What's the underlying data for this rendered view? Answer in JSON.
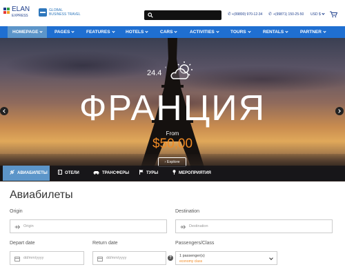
{
  "header": {
    "logo": {
      "name": "ELAN",
      "sub": "EXPRESS"
    },
    "partner": {
      "line1": "GLOBAL",
      "line2": "BUSINESS TRAVEL"
    },
    "phones": [
      "+(99890) 970-12-34",
      "+(99871) 150-25-50"
    ],
    "currency": "USD $"
  },
  "nav": {
    "items": [
      {
        "label": "Homepage"
      },
      {
        "label": "Pages"
      },
      {
        "label": "Features"
      },
      {
        "label": "Hotels"
      },
      {
        "label": "Cars"
      },
      {
        "label": "Activities"
      },
      {
        "label": "Tours"
      },
      {
        "label": "Rentals"
      },
      {
        "label": "Partner"
      }
    ]
  },
  "hero": {
    "temperature": "24.4",
    "degree": "°",
    "title": "ФРАНЦИЯ",
    "from_label": "From",
    "price": "$50,00",
    "cta": "Explore"
  },
  "tabs": [
    {
      "label": "АВИАБИЛЕТЫ",
      "icon": "plane-icon",
      "active": true
    },
    {
      "label": "ОТЕЛИ",
      "icon": "building-icon"
    },
    {
      "label": "ТРАНСФЕРЫ",
      "icon": "car-icon"
    },
    {
      "label": "ТУРЫ",
      "icon": "flag-icon"
    },
    {
      "label": "МЕРОПРИЯТИЯ",
      "icon": "pin-icon"
    }
  ],
  "form": {
    "title": "Авиабилеты",
    "origin": {
      "label": "Origin",
      "placeholder": "Origin"
    },
    "destination": {
      "label": "Destination",
      "placeholder": "Destination"
    },
    "depart": {
      "label": "Depart date",
      "placeholder": "dd/mm/yyyy"
    },
    "return": {
      "label": "Return date",
      "placeholder": "dd/mm/yyyy"
    },
    "passengers": {
      "label": "Passengers/Class",
      "value": "1 passenger(s)",
      "class": "economy class"
    },
    "help": "?"
  },
  "colors": {
    "nav": "#1f6fd1",
    "active_tab": "#5c95c9",
    "accent": "#f08a24"
  }
}
